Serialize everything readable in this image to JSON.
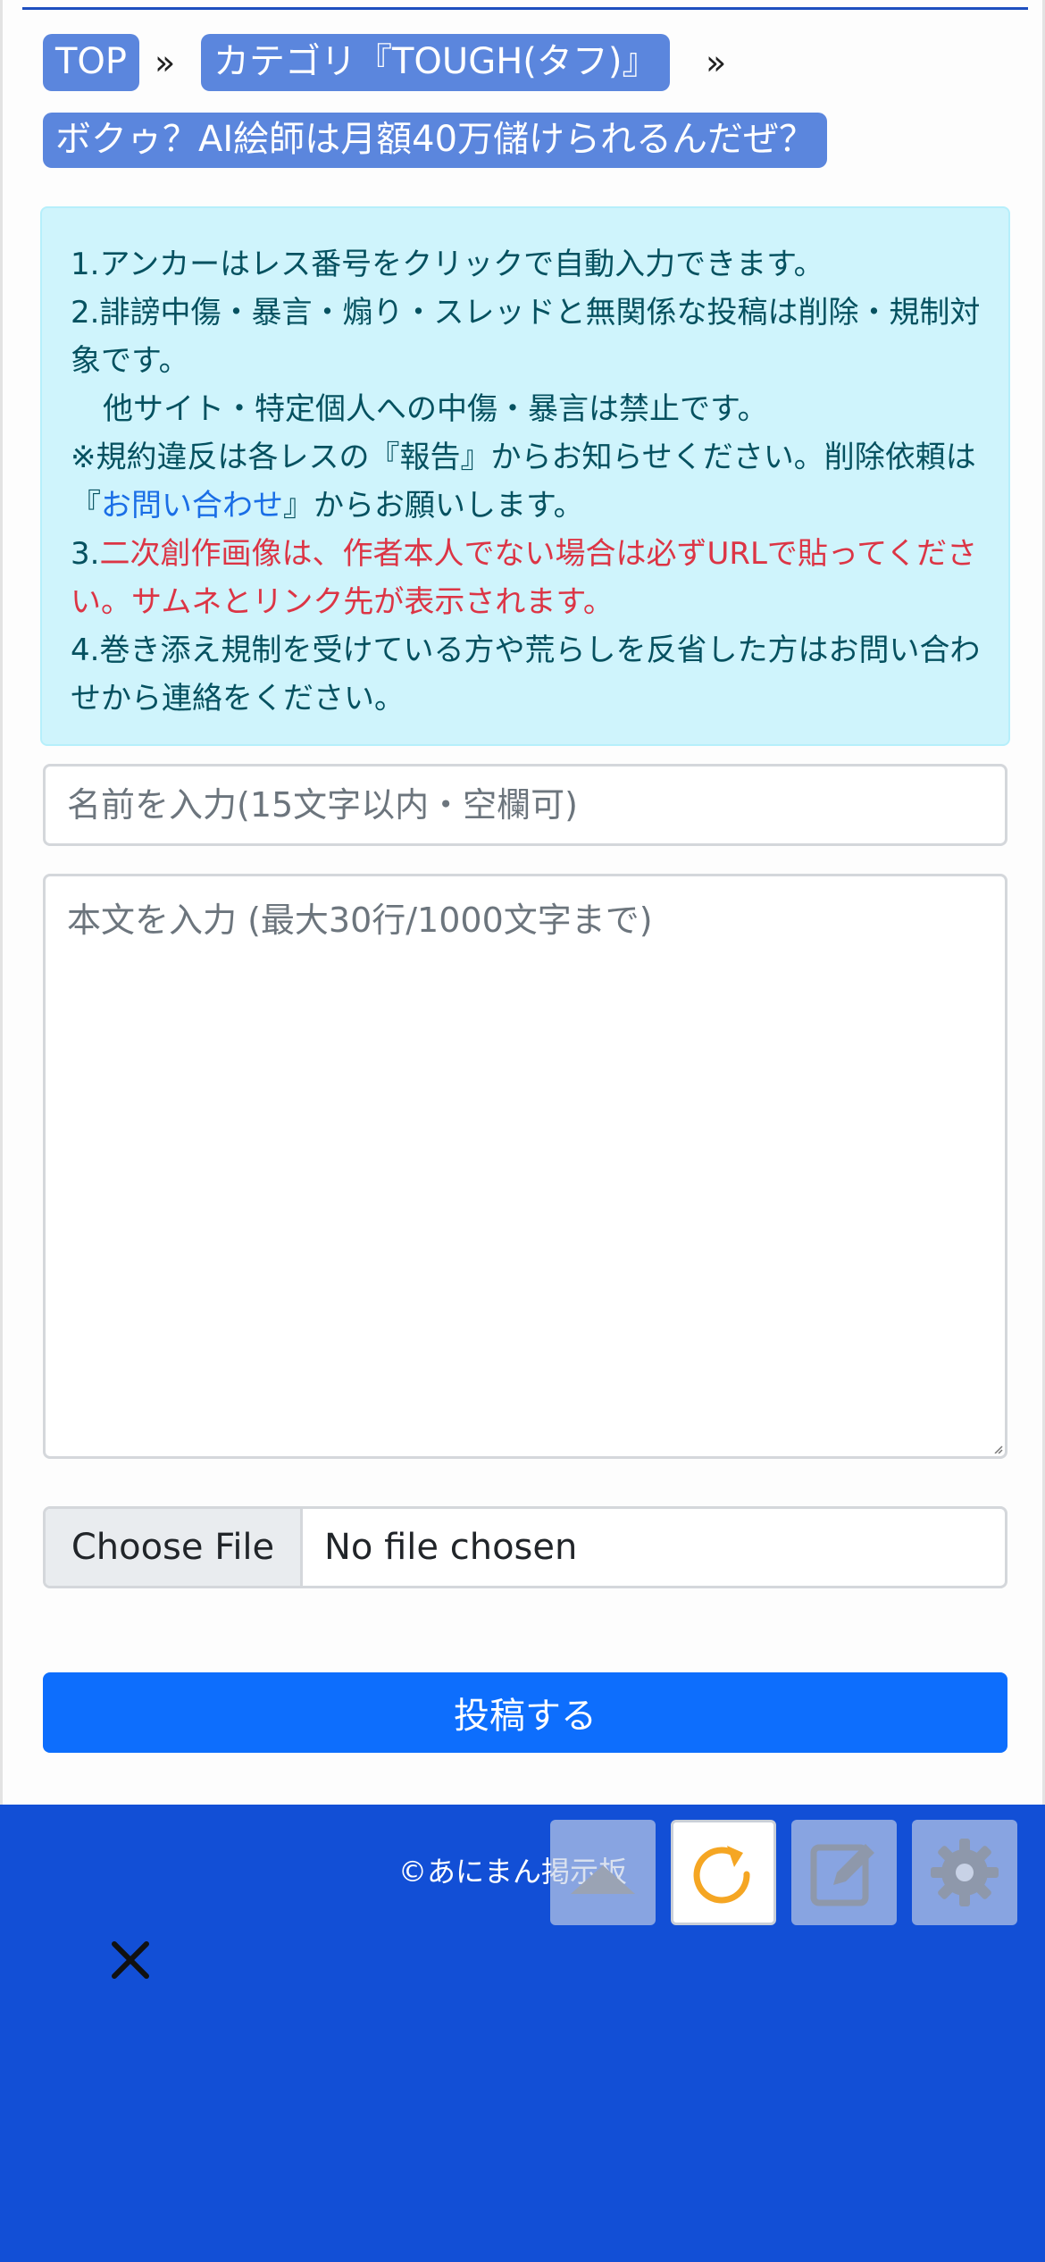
{
  "breadcrumb": {
    "top": "TOP",
    "separator": "»",
    "category": "カテゴリ『TOUGH(タフ)』",
    "thread": "ボクゥ？AI絵師は月額40万儲けられるんだぜ？"
  },
  "rules": {
    "line1": "1.アンカーはレス番号をクリックで自動入力できます。",
    "line2": "2.誹謗中傷・暴言・煽り・スレッドと無関係な投稿は削除・規制対象です。",
    "line2b": "他サイト・特定個人への中傷・暴言は禁止です。",
    "line2c_pre": "※規約違反は各レスの『報告』からお知らせください。削除依頼は『",
    "line2c_link": "お問い合わせ",
    "line2c_post": "』からお願いします。",
    "line3_num": "3.",
    "line3": "二次創作画像は、作者本人でない場合は必ずURLで貼ってください。サムネとリンク先が表示されます。",
    "line4": "4.巻き添え規制を受けている方や荒らしを反省した方はお問い合わせから連絡をください。"
  },
  "form": {
    "name_placeholder": "名前を入力(15文字以内・空欄可)",
    "body_placeholder": "本文を入力 (最大30行/1000文字まで)",
    "file_button": "Choose File",
    "file_status": "No file chosen",
    "submit": "投稿する"
  },
  "footer": {
    "copyright": "©あにまん掲示板"
  },
  "floating_buttons": [
    "scroll-up-icon",
    "reload-icon",
    "edit-icon",
    "gear-icon"
  ],
  "colors": {
    "breadcrumb_bg": "#5b86dd",
    "alert_bg": "#cff4fc",
    "submit_bg": "#0d6efd",
    "footer_bg": "#124fd6",
    "reload_accent": "#f5a623"
  }
}
